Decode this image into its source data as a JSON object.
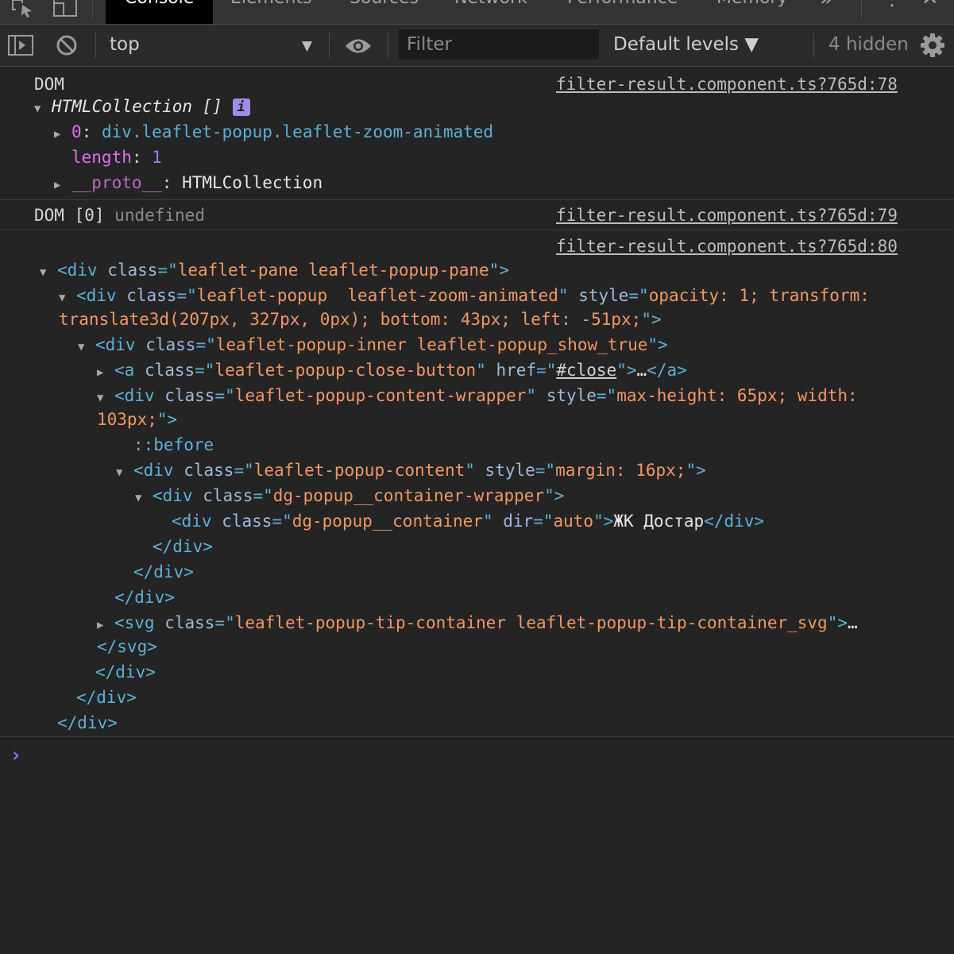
{
  "tabs": {
    "items": [
      "Console",
      "Elements",
      "Sources",
      "Network",
      "Performance",
      "Memory"
    ],
    "more": "»",
    "menu": "⋮",
    "close": "✕"
  },
  "toolbar": {
    "context": "top",
    "filter_placeholder": "Filter",
    "levels": "Default levels ▼",
    "hidden": "4 hidden"
  },
  "console": {
    "m1": {
      "label": "DOM",
      "source": "filter-result.component.ts?765d:78",
      "collection": "HTMLCollection []",
      "info": "i",
      "item0_key": "0",
      "item0_val": "div.leaflet-popup.leaflet-zoom-animated",
      "length_key": "length",
      "length_val": "1",
      "proto_key": "__proto__",
      "proto_val": "HTMLCollection"
    },
    "m2": {
      "label": "DOM [0]",
      "value": "undefined",
      "source": "filter-result.component.ts?765d:79"
    },
    "m3": {
      "source": "filter-result.component.ts?765d:80",
      "pane_class": "leaflet-pane leaflet-popup-pane",
      "popup_class": "leaflet-popup  leaflet-zoom-animated",
      "popup_style_a": "opacity: 1; transform:",
      "popup_style_b": "translate3d(207px, 327px, 0px); bottom: 43px; left: -51px;",
      "inner_class": "leaflet-popup-inner leaflet-popup_show_true",
      "close_class": "leaflet-popup-close-button",
      "close_href": "#close",
      "wrapper_class": "leaflet-popup-content-wrapper",
      "wrapper_style_a": "max-height: 65px; width:",
      "wrapper_style_b": "103px;",
      "before": "::before",
      "content_class": "leaflet-popup-content",
      "content_style": "margin: 16px;",
      "dg_wrapper_class": "dg-popup__container-wrapper",
      "dg_container_class": "dg-popup__container",
      "dg_dir": "auto",
      "dg_text": "ЖК Достар",
      "svg_class": "leaflet-popup-tip-container leaflet-popup-tip-container_svg"
    }
  }
}
